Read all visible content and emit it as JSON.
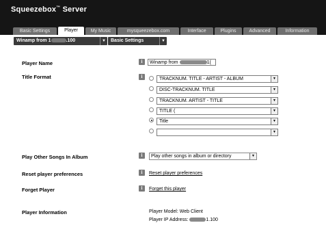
{
  "app": {
    "title": "Squeezebox",
    "title_mark": "™",
    "title_suffix": " Server"
  },
  "tabs": [
    {
      "label": "Basic Settings"
    },
    {
      "label": "Player"
    },
    {
      "label": "My Music"
    },
    {
      "label": "mysqueezebox.com"
    },
    {
      "label": "Interface"
    },
    {
      "label": "Plugins"
    },
    {
      "label": "Advanced"
    },
    {
      "label": "Information"
    }
  ],
  "subbar": {
    "player_select_prefix": "Winamp from 1",
    "player_select_suffix": ".100",
    "settings_select": "Basic Settings",
    "arrow": "▼"
  },
  "info_icon": "i",
  "player_name": {
    "label": "Player Name",
    "value_prefix": "Winamp from ",
    "value_suffix": "1("
  },
  "title_format": {
    "label": "Title Format",
    "options": [
      {
        "text": "TRACKNUM. TITLE - ARTIST - ALBUM",
        "selected": false
      },
      {
        "text": "DISC-TRACKNUM. TITLE",
        "selected": false
      },
      {
        "text": "TRACKNUM. ARTIST - TITLE",
        "selected": false
      },
      {
        "text": "TITLE (",
        "selected": false
      },
      {
        "text": "Title",
        "selected": true
      },
      {
        "text": "",
        "selected": false
      }
    ]
  },
  "play_other": {
    "label": "Play Other Songs In Album",
    "value": "Play other songs in album or directory"
  },
  "reset": {
    "label": "Reset player preferences",
    "action": "Reset player preferences"
  },
  "forget": {
    "label": "Forget Player",
    "action": "Forget this player"
  },
  "player_info": {
    "label": "Player Information",
    "model": "Player Model: Web Client",
    "ip_prefix": "Player IP Address: ",
    "ip_suffix": "1.100"
  }
}
